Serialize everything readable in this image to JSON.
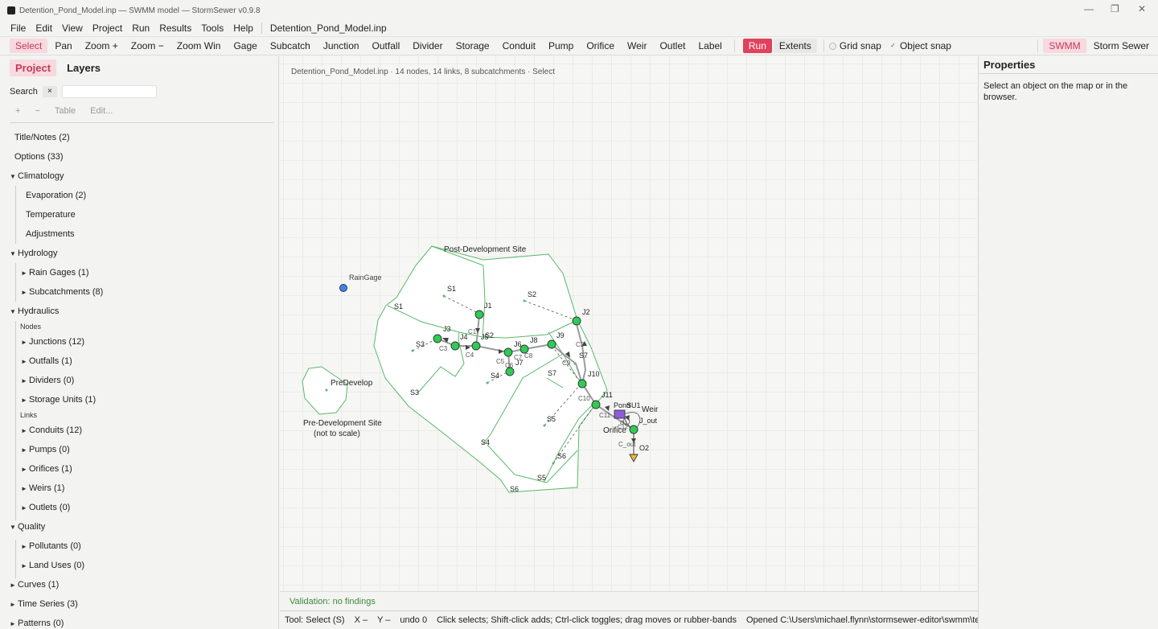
{
  "window": {
    "title": "Detention_Pond_Model.inp — SWMM model — StormSewer v0.9.8",
    "minimize": "—",
    "maximize": "❐",
    "close": "✕"
  },
  "menu": {
    "items": [
      "File",
      "Edit",
      "View",
      "Project",
      "Run",
      "Results",
      "Tools",
      "Help"
    ],
    "doc_tab": "Detention_Pond_Model.inp"
  },
  "toolbar": {
    "tools": [
      "Select",
      "Pan",
      "Zoom +",
      "Zoom −",
      "Zoom Win",
      "Gage",
      "Subcatch",
      "Junction",
      "Outfall",
      "Divider",
      "Storage",
      "Conduit",
      "Pump",
      "Orifice",
      "Weir",
      "Outlet",
      "Label"
    ],
    "run": "Run",
    "extents": "Extents",
    "grid_snap": "Grid snap",
    "grid_snap_checked": false,
    "object_snap": "Object snap",
    "object_snap_checked": true,
    "mode_swmm": "SWMM",
    "mode_storm": "Storm Sewer",
    "accent": "#c23b58",
    "run_color": "#e0425c"
  },
  "sidebar": {
    "tabs": [
      "Project",
      "Layers"
    ],
    "search_label": "Search",
    "search_clear": "×",
    "search_value": "",
    "buttons": [
      "+",
      "−",
      "Table",
      "Edit..."
    ],
    "tree": {
      "title_notes": "Title/Notes (2)",
      "options": "Options (33)",
      "climatology": "Climatology",
      "evaporation": "Evaporation (2)",
      "temperature": "Temperature",
      "adjustments": "Adjustments",
      "hydrology": "Hydrology",
      "rain_gages": "Rain Gages (1)",
      "subcatchments": "Subcatchments (8)",
      "hydraulics": "Hydraulics",
      "nodes": "Nodes",
      "junctions": "Junctions (12)",
      "outfalls": "Outfalls (1)",
      "dividers": "Dividers (0)",
      "storage_units": "Storage Units (1)",
      "links": "Links",
      "conduits": "Conduits (12)",
      "pumps": "Pumps (0)",
      "orifices": "Orifices (1)",
      "weirs": "Weirs (1)",
      "outlets": "Outlets (0)",
      "quality": "Quality",
      "pollutants": "Pollutants (0)",
      "land_uses": "Land Uses (0)",
      "curves": "Curves (1)",
      "time_series": "Time Series (3)",
      "patterns": "Patterns (0)"
    }
  },
  "map": {
    "info": "Detention_Pond_Model.inp  ·  14 nodes, 14 links, 8 subcatchments  ·  Select",
    "labels": {
      "post_site": "Post-Development Site",
      "pre_site_1": "Pre-Development Site",
      "pre_site_2": "(not to scale)",
      "predevelop": "PreDevelop",
      "raingage": "RainGage",
      "orifice": "Orifice",
      "weir": "Weir",
      "j_out": "J_out",
      "pond": "Pond",
      "su1": "SU1",
      "c_out": "C_out",
      "o2": "O2"
    },
    "subcatchments": [
      "S1",
      "S2",
      "S3",
      "S4",
      "S5",
      "S6",
      "S7"
    ],
    "junctions": [
      "J1",
      "J2",
      "J3",
      "J4",
      "J5",
      "J6",
      "J7",
      "J8",
      "J9",
      "J10",
      "J11"
    ],
    "conduits": [
      "C1",
      "C2",
      "C3",
      "C4",
      "C5",
      "C6",
      "C7",
      "C8",
      "C9",
      "C10",
      "C11"
    ],
    "misc_labels": {
      "c12": "C12",
      "s2_tag": "S2",
      "or_tag": "O1"
    },
    "node_color": "#2ecc55",
    "gage_color": "#3b82f6",
    "storage_color": "#8e5cd9",
    "outfall_color": "#f0b72f",
    "outline_color": "#58b86a"
  },
  "properties": {
    "header": "Properties",
    "hint": "Select an object on the map or in the browser."
  },
  "validation": "Validation: no findings",
  "status": {
    "tool": "Tool: Select (S)",
    "x": "X –",
    "y": "Y –",
    "undo": "undo 0",
    "hint": "Click selects; Shift-click adds; Ctrl-click toggles; drag moves or rubber-bands",
    "opened": "Opened C:\\Users\\michael.flynn\\stormsewer-editor\\swmm\\tests"
  }
}
